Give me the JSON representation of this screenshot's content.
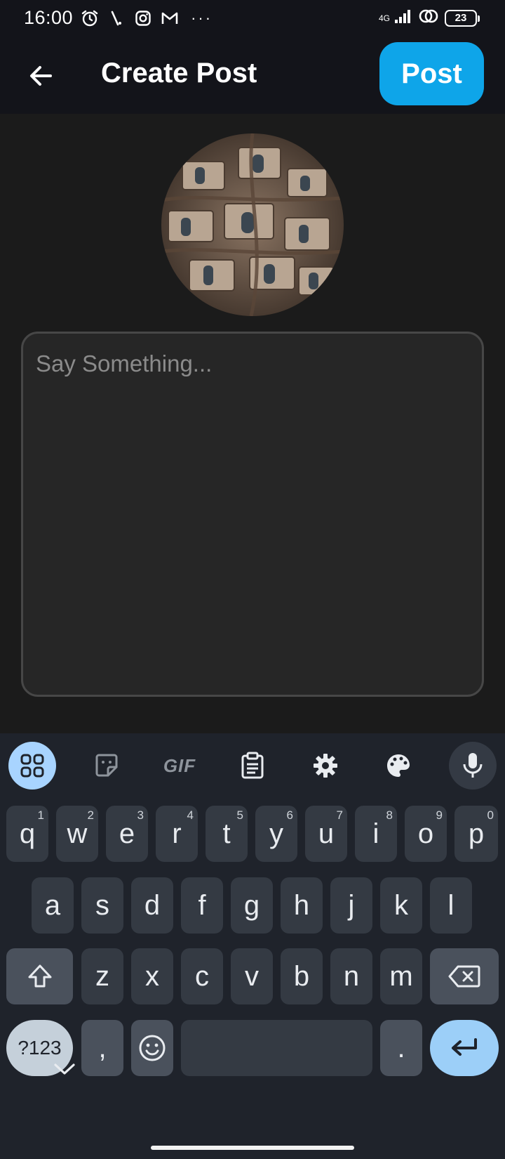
{
  "status_bar": {
    "time": "16:00",
    "network": "4G",
    "battery": "23",
    "more": "···"
  },
  "app_bar": {
    "title": "Create Post",
    "post_label": "Post"
  },
  "composer": {
    "placeholder": "Say Something...",
    "value": ""
  },
  "keyboard": {
    "toolbar": {
      "gif_label": "GIF"
    },
    "row1": [
      {
        "k": "q",
        "n": "1"
      },
      {
        "k": "w",
        "n": "2"
      },
      {
        "k": "e",
        "n": "3"
      },
      {
        "k": "r",
        "n": "4"
      },
      {
        "k": "t",
        "n": "5"
      },
      {
        "k": "y",
        "n": "6"
      },
      {
        "k": "u",
        "n": "7"
      },
      {
        "k": "i",
        "n": "8"
      },
      {
        "k": "o",
        "n": "9"
      },
      {
        "k": "p",
        "n": "0"
      }
    ],
    "row2": [
      "a",
      "s",
      "d",
      "f",
      "g",
      "h",
      "j",
      "k",
      "l"
    ],
    "row3": [
      "z",
      "x",
      "c",
      "v",
      "b",
      "n",
      "m"
    ],
    "row4": {
      "symbols": "?123",
      "comma": ",",
      "period": "."
    }
  },
  "colors": {
    "accent": "#0ea5e9",
    "background": "#1b1b1b",
    "appbar": "#13141a",
    "keyboard": "#1f232b"
  }
}
